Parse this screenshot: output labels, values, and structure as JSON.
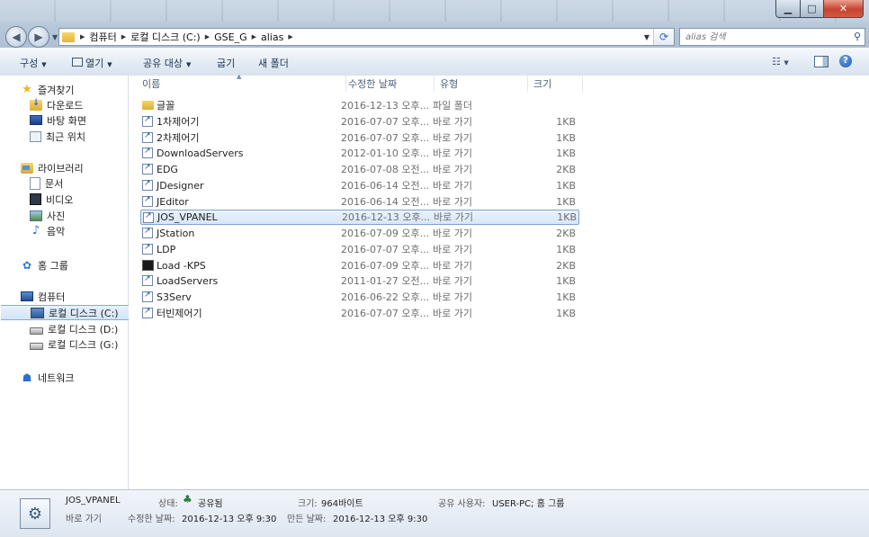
{
  "window": {
    "caption_buttons": {
      "minimize": "▁",
      "maximize": "□",
      "close": "✕"
    }
  },
  "navigation": {
    "back_icon": "back-arrow-icon",
    "forward_icon": "forward-arrow-icon"
  },
  "address": {
    "breadcrumbs": [
      "컴퓨터",
      "로컬 디스크 (C:)",
      "GSE_G",
      "alias"
    ]
  },
  "search": {
    "placeholder": "alias 검색"
  },
  "toolbar": {
    "organize": "구성",
    "open": "열기",
    "share": "공유 대상",
    "burn": "굽기",
    "new_folder": "새 폴더"
  },
  "sidebar": {
    "favorites": {
      "label": "즐겨찾기",
      "items": [
        "다운로드",
        "바탕 화면",
        "최근 위치"
      ]
    },
    "libraries": {
      "label": "라이브러리",
      "items": [
        "문서",
        "비디오",
        "사진",
        "음악"
      ]
    },
    "homegroup": {
      "label": "홈 그룹"
    },
    "computer": {
      "label": "컴퓨터",
      "items": [
        "로컬 디스크 (C:)",
        "로컬 디스크 (D:)",
        "로컬 디스크 (G:)"
      ],
      "selected": "로컬 디스크 (C:)"
    },
    "network": {
      "label": "네트워크"
    }
  },
  "columns": {
    "name": "이름",
    "modified": "수정한 날짜",
    "type": "유형",
    "size": "크기"
  },
  "files": [
    {
      "name": "글꼴",
      "modified": "2016-12-13 오후...",
      "type": "파일 폴더",
      "size": "",
      "icon": "folder"
    },
    {
      "name": "1차제어기",
      "modified": "2016-07-07 오후...",
      "type": "바로 가기",
      "size": "1KB",
      "icon": "shortcut"
    },
    {
      "name": "2차제어기",
      "modified": "2016-07-07 오후...",
      "type": "바로 가기",
      "size": "1KB",
      "icon": "shortcut"
    },
    {
      "name": "DownloadServers",
      "modified": "2012-01-10 오후...",
      "type": "바로 가기",
      "size": "1KB",
      "icon": "shortcut"
    },
    {
      "name": "EDG",
      "modified": "2016-07-08 오전...",
      "type": "바로 가기",
      "size": "2KB",
      "icon": "shortcut"
    },
    {
      "name": "JDesigner",
      "modified": "2016-06-14 오전...",
      "type": "바로 가기",
      "size": "1KB",
      "icon": "shortcut"
    },
    {
      "name": "JEditor",
      "modified": "2016-06-14 오전...",
      "type": "바로 가기",
      "size": "1KB",
      "icon": "shortcut"
    },
    {
      "name": "JOS_VPANEL",
      "modified": "2016-12-13 오후...",
      "type": "바로 가기",
      "size": "1KB",
      "icon": "shortcut",
      "selected": true
    },
    {
      "name": "JStation",
      "modified": "2016-07-09 오후...",
      "type": "바로 가기",
      "size": "2KB",
      "icon": "shortcut"
    },
    {
      "name": "LDP",
      "modified": "2016-07-07 오후...",
      "type": "바로 가기",
      "size": "1KB",
      "icon": "shortcut"
    },
    {
      "name": "Load -KPS",
      "modified": "2016-07-09 오후...",
      "type": "바로 가기",
      "size": "2KB",
      "icon": "cmd"
    },
    {
      "name": "LoadServers",
      "modified": "2011-01-27 오전...",
      "type": "바로 가기",
      "size": "1KB",
      "icon": "shortcut"
    },
    {
      "name": "S3Serv",
      "modified": "2016-06-22 오후...",
      "type": "바로 가기",
      "size": "1KB",
      "icon": "shortcut"
    },
    {
      "name": "터빈제어기",
      "modified": "2016-07-07 오후...",
      "type": "바로 가기",
      "size": "1KB",
      "icon": "shortcut"
    }
  ],
  "details": {
    "name": "JOS_VPANEL",
    "kind": "바로 가기",
    "state_label": "상태:",
    "state_value": "공유됨",
    "size_label": "크기:",
    "size_value": "964바이트",
    "shared_label": "공유 사용자:",
    "shared_value": "USER-PC; 홈 그룹",
    "modified_label": "수정한 날짜:",
    "modified_value": "2016-12-13 오후 9:30",
    "created_label": "만든 날짜:",
    "created_value": "2016-12-13 오후 9:30"
  }
}
